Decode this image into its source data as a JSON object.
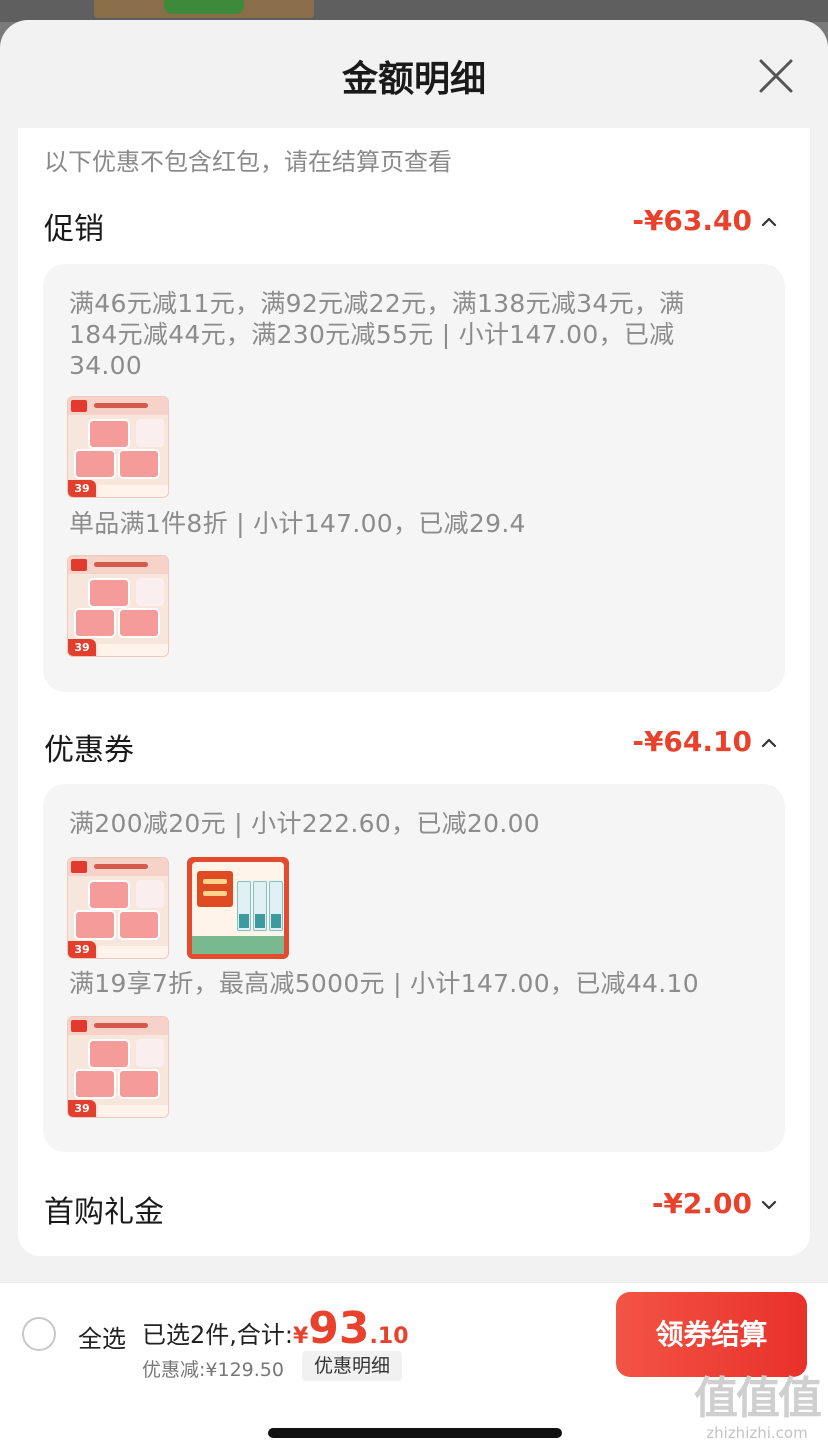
{
  "sheet": {
    "title": "金额明细",
    "close_icon": "close-icon"
  },
  "note": "以下优惠不包含红包，请在结算页查看",
  "sections": {
    "promo": {
      "label": "促销",
      "amount": "-¥63.40",
      "expanded": true,
      "rules": [
        {
          "text": "满46元减11元，满92元减22元，满138元减34元，满184元减44元，满230元减55元 | 小计147.00，已减34.00"
        },
        {
          "text": "单品满1件8折 | 小计147.00，已减29.4"
        }
      ],
      "product_price_tag": "39"
    },
    "coupon": {
      "label": "优惠券",
      "amount": "-¥64.10",
      "expanded": true,
      "rules": [
        {
          "text": "满200减20元 | 小计222.60，已减20.00"
        },
        {
          "text": "满19享7折，最高减5000元 | 小计147.00，已减44.10"
        }
      ],
      "product_price_tag": "39"
    },
    "first_gift": {
      "label": "首购礼金",
      "amount": "-¥2.00",
      "expanded": false
    }
  },
  "bottom": {
    "select_all": "全选",
    "selected_text": "已选2件,合计:",
    "currency": "¥",
    "total_int": "93",
    "total_dec": ".10",
    "saved_text": "优惠减:¥129.50",
    "detail_link": "优惠明细",
    "checkout": "领券结算"
  },
  "watermark": {
    "logo": "值值值",
    "url": "zhizhizhi.com"
  },
  "colors": {
    "accent": "#e8412c",
    "checkout_gradient_start": "#f35445",
    "checkout_gradient_end": "#e8312a"
  }
}
